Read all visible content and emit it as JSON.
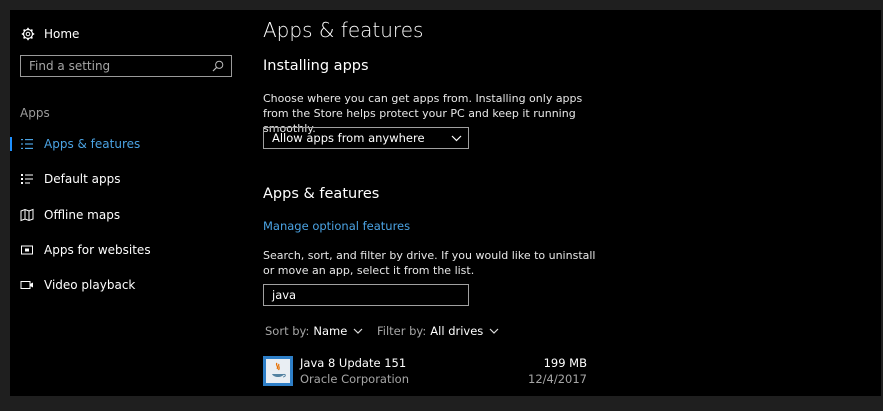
{
  "sidebar": {
    "home_label": "Home",
    "search_placeholder": "Find a setting",
    "section_title": "Apps",
    "items": [
      {
        "label": "Apps & features",
        "icon": "list-icon",
        "active": true
      },
      {
        "label": "Default apps",
        "icon": "default-apps-icon"
      },
      {
        "label": "Offline maps",
        "icon": "map-icon"
      },
      {
        "label": "Apps for websites",
        "icon": "web-apps-icon"
      },
      {
        "label": "Video playback",
        "icon": "video-icon"
      }
    ]
  },
  "main": {
    "title": "Apps & features",
    "installing": {
      "heading": "Installing apps",
      "description": "Choose where you can get apps from. Installing only apps from the Store helps protect your PC and keep it running smoothly.",
      "dropdown_value": "Allow apps from anywhere"
    },
    "apps": {
      "heading": "Apps & features",
      "manage_link": "Manage optional features",
      "description": "Search, sort, and filter by drive. If you would like to uninstall or move an app, select it from the list.",
      "search_value": "java",
      "sort_label": "Sort by:",
      "sort_value": "Name",
      "filter_label": "Filter by:",
      "filter_value": "All drives",
      "list": [
        {
          "name": "Java 8 Update 151",
          "publisher": "Oracle Corporation",
          "size": "199 MB",
          "date": "12/4/2017",
          "icon": "java-icon"
        }
      ]
    }
  },
  "colors": {
    "accent": "#4ba3e3",
    "background": "#000000",
    "frame": "#1f1f1f"
  }
}
